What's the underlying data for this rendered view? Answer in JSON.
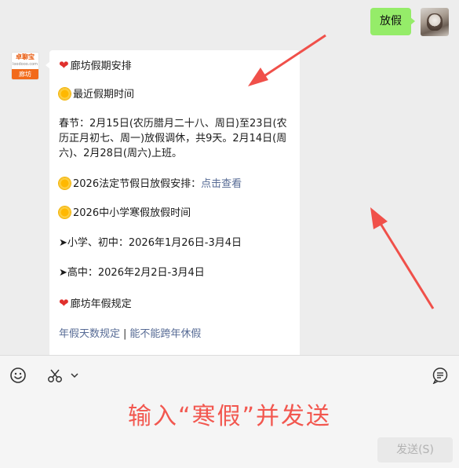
{
  "outgoing": {
    "text": "放假"
  },
  "bot_avatar": {
    "logo_text": "卓聊宝",
    "logo_sub": "loodooo.com",
    "badge": "廊坊"
  },
  "message": {
    "l1": "廊坊假期安排",
    "l2": "最近假期时间",
    "para": "春节：2月15日(农历腊月二十八、周日)至23日(农历正月初七、周一)放假调休，共9天。2月14日(周六)、2月28日(周六)上班。",
    "l3_prefix": "2026法定节假日放假安排：",
    "l3_link": "点击查看",
    "l4": "2026中小学寒假放假时间",
    "l5": "➤小学、初中：2026年1月26日-3月4日",
    "l6": "➤高中：2026年2月2日-3月4日",
    "l7": "廊坊年假规定",
    "link1": "年假天数规定",
    "sep": "|",
    "link2": "能不能跨年休假"
  },
  "input": {
    "hint": "输入“寒假”并发送",
    "send_label": "发送(S)",
    "icons": [
      "emoji-icon",
      "scissors-icon",
      "chat-bubble-icon"
    ]
  },
  "colors": {
    "bubble_out": "#95ec69",
    "hint": "#f2574f",
    "link": "#576b95",
    "arrow": "#f0504a"
  }
}
